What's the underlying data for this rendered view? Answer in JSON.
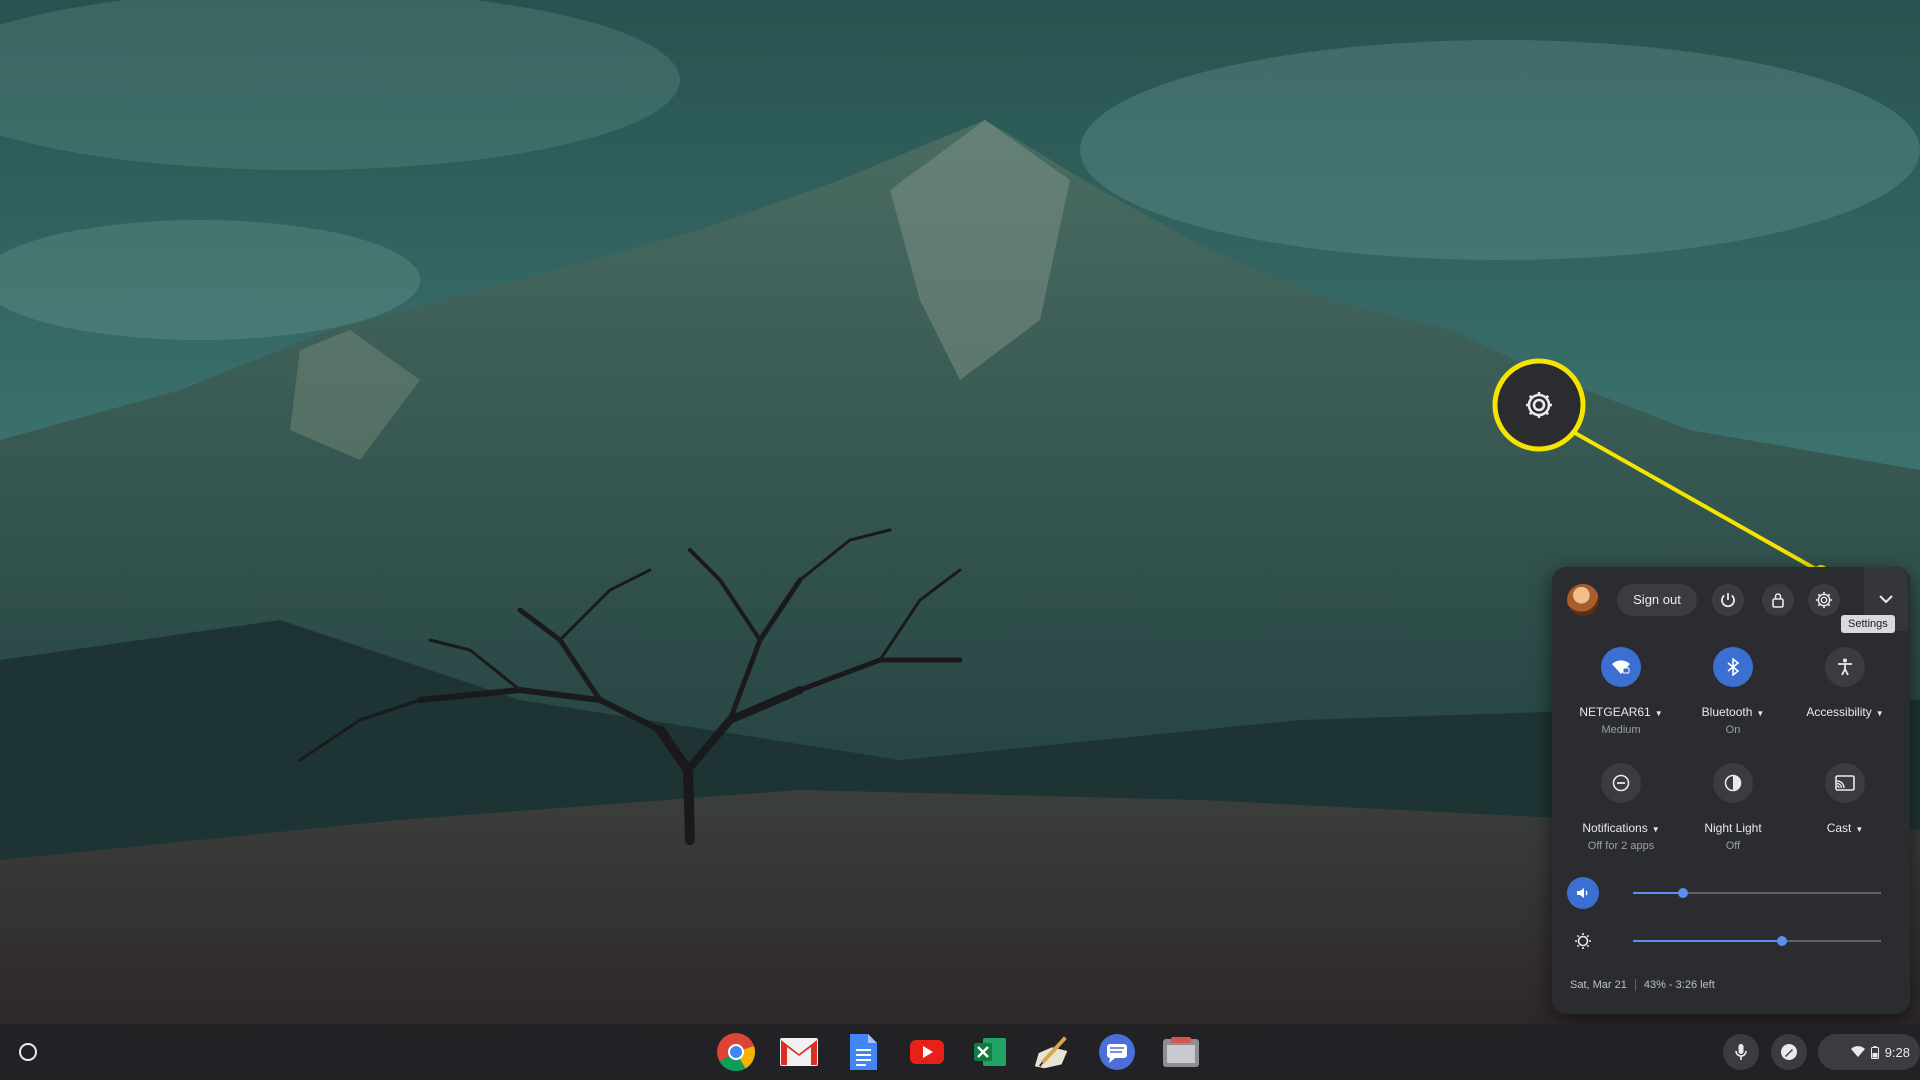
{
  "quick_settings": {
    "sign_out_label": "Sign out",
    "tooltip": "Settings",
    "features": [
      {
        "label": "NETGEAR61",
        "sub": "Medium",
        "icon": "wifi-icon",
        "on": true,
        "dropdown": true
      },
      {
        "label": "Bluetooth",
        "sub": "On",
        "icon": "bluetooth-icon",
        "on": true,
        "dropdown": true
      },
      {
        "label": "Accessibility",
        "sub": "",
        "icon": "accessibility-icon",
        "on": false,
        "dropdown": true
      },
      {
        "label": "Notifications",
        "sub": "Off for 2 apps",
        "icon": "do-not-disturb-icon",
        "on": false,
        "dropdown": true
      },
      {
        "label": "Night Light",
        "sub": "Off",
        "icon": "night-light-icon",
        "on": false,
        "dropdown": false
      },
      {
        "label": "Cast",
        "sub": "",
        "icon": "cast-icon",
        "on": false,
        "dropdown": true
      }
    ],
    "volume_level": 0.2,
    "brightness_level": 0.6,
    "date": "Sat, Mar 21",
    "battery": "43% - 3:26 left"
  },
  "shelf": {
    "apps": [
      "chrome-icon",
      "gmail-icon",
      "docs-icon",
      "youtube-icon",
      "excel-icon",
      "sketch-app-icon",
      "messages-icon",
      "files-app-icon"
    ],
    "time": "9:28"
  },
  "colors": {
    "accent": "#3b6fd1",
    "highlight": "#f5e400",
    "panel": "#2a2c2f"
  }
}
